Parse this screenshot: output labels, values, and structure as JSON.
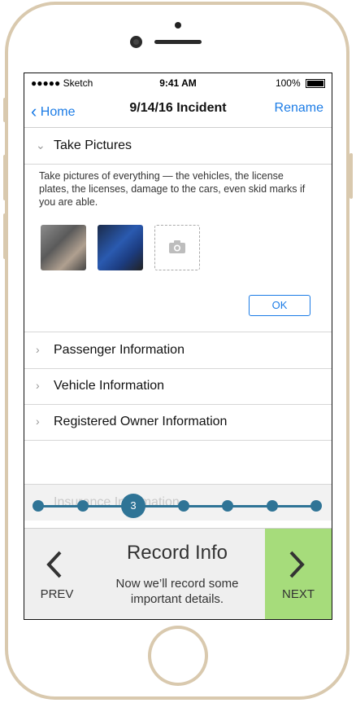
{
  "status": {
    "carrier": "●●●●● Sketch",
    "time": "9:41 AM",
    "battery": "100%"
  },
  "nav": {
    "back_label": "Home",
    "title": "9/14/16 Incident",
    "right_label": "Rename"
  },
  "sections": {
    "take_pictures": {
      "label": "Take Pictures",
      "description": "Take pictures of everything — the vehicles, the license plates, the licenses, damage to the cars, even skid marks if you are able.",
      "ok_label": "OK"
    },
    "passenger": "Passenger Information",
    "vehicle": "Vehicle Information",
    "owner": "Registered Owner Information",
    "insurance": "Insurance Information"
  },
  "stepper": {
    "current_step": "3",
    "total_steps": 7
  },
  "footer": {
    "prev_label": "PREV",
    "next_label": "NEXT",
    "title": "Record Info",
    "subtitle": "Now we’ll record some important details."
  },
  "colors": {
    "accent": "#1c7ce6",
    "stepper": "#2f7496",
    "next_bg": "#a6dc7b"
  }
}
